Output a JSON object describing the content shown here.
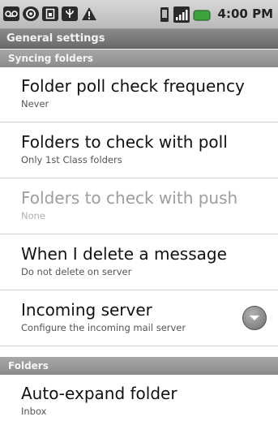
{
  "status_bar": {
    "time": "4:00 PM",
    "icons": [
      "voicemail-icon",
      "sync-icon",
      "sim-icon",
      "usb-icon",
      "warning-icon",
      "vibrate-icon",
      "signal-icon",
      "battery-icon"
    ]
  },
  "header": {
    "title": "General settings"
  },
  "sections": [
    {
      "label": "Syncing folders",
      "items": [
        {
          "title": "Folder poll check frequency",
          "summary": "Never"
        },
        {
          "title": "Folders to check with poll",
          "summary": "Only 1st Class folders"
        },
        {
          "title": "Folders to check with push",
          "summary": "None"
        },
        {
          "title": "When I delete a message",
          "summary": "Do not delete on server"
        },
        {
          "title": "Incoming server",
          "summary": "Configure the incoming mail server"
        }
      ]
    },
    {
      "label": "Folders",
      "items": [
        {
          "title": "Auto-expand folder",
          "summary": "Inbox"
        }
      ]
    }
  ],
  "colors": {
    "background": "#ffffff",
    "section_header": "#999999",
    "disabled_text": "#9d9d9d",
    "battery": "#3ea23e"
  }
}
